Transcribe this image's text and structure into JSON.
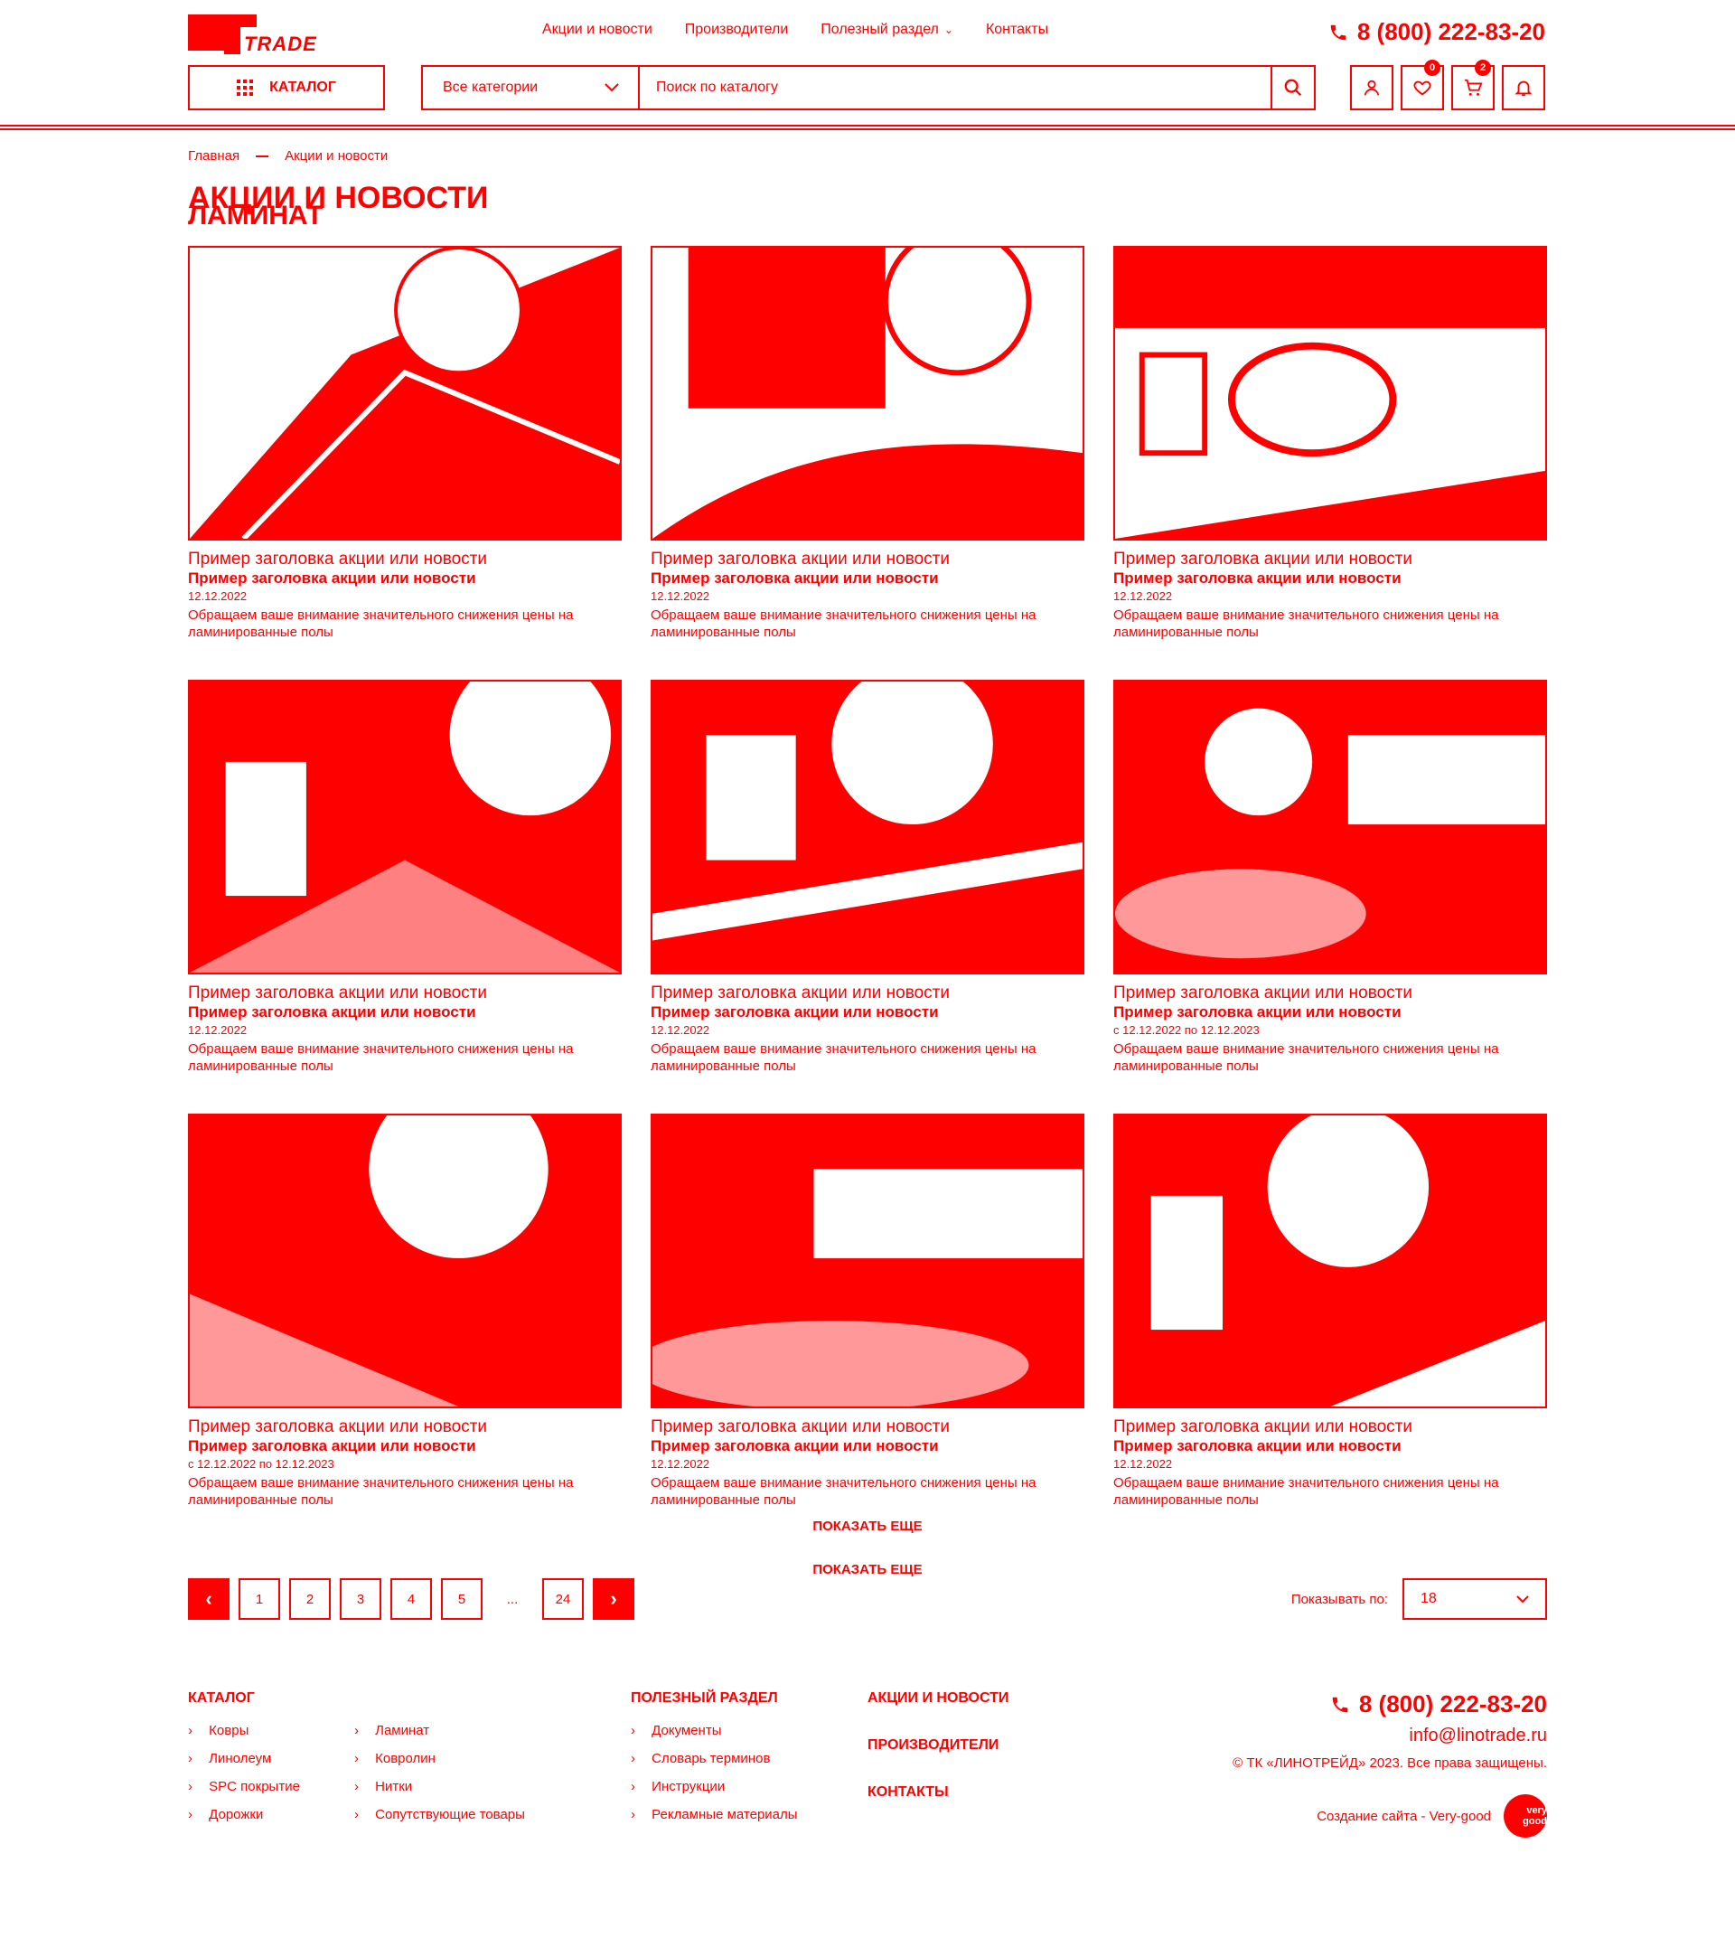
{
  "header": {
    "logo_text": "TRADE",
    "nav": [
      {
        "label": "Акции и новости"
      },
      {
        "label": "Производители"
      },
      {
        "label": "Полезный раздел",
        "dropdown": true
      },
      {
        "label": "Контакты"
      }
    ],
    "phone": "8 (800) 222-83-20",
    "catalog_label": "Каталог",
    "category_select": "Все категории",
    "search_placeholder": "Поиск по каталогу",
    "badges": {
      "favorites": "0",
      "cart": "2"
    }
  },
  "breadcrumb": {
    "home": "Главная",
    "current": "Акции и новости"
  },
  "page": {
    "title": "Акции и новости",
    "subtitle": "Ламинат"
  },
  "cards": [
    {
      "title": "Пример заголовка акции или новости",
      "date": "12.12.2022",
      "desc": "Обращаем ваше внимание значительного снижения цены на ламинированные полы"
    },
    {
      "title": "Пример заголовка акции или новости",
      "date": "12.12.2022",
      "desc": "Обращаем ваше внимание значительного снижения цены на ламинированные полы"
    },
    {
      "title": "Пример заголовка акции или новости",
      "date": "12.12.2022",
      "desc": "Обращаем ваше внимание значительного снижения цены на ламинированные полы"
    },
    {
      "title": "Пример заголовка акции или новости",
      "date": "12.12.2022",
      "desc": "Обращаем ваше внимание значительного снижения цены на ламинированные полы"
    },
    {
      "title": "Пример заголовка акции или новости",
      "date": "12.12.2022",
      "desc": "Обращаем ваше внимание значительного снижения цены на ламинированные полы"
    },
    {
      "title": "Пример заголовка акции или новости",
      "date": "с 12.12.2022 по 12.12.2023",
      "desc": "Обращаем ваше внимание значительного снижения цены на ламинированные полы"
    },
    {
      "title": "Пример заголовка акции или новости",
      "date": "с 12.12.2022 по 12.12.2023",
      "desc": "Обращаем ваше внимание значительного снижения цены на ламинированные полы"
    },
    {
      "title": "Пример заголовка акции или новости",
      "date": "12.12.2022",
      "desc": "Обращаем ваше внимание значительного снижения цены на ламинированные полы"
    },
    {
      "title": "Пример заголовка акции или новости",
      "date": "12.12.2022",
      "desc": "Обращаем ваше внимание значительного снижения цены на ламинированные полы"
    }
  ],
  "show_more": "Показать еще",
  "pagination": {
    "pages": [
      "1",
      "2",
      "3",
      "4",
      "5",
      "...",
      "24"
    ],
    "per_page_label": "Показывать по:",
    "per_page_value": "18"
  },
  "footer": {
    "catalog_title": "Каталог",
    "catalog_items_1": [
      "Ковры",
      "Линолеум",
      "SPC покрытие",
      "Дорожки"
    ],
    "catalog_items_2": [
      "Ламинат",
      "Ковролин",
      "Нитки",
      "Сопутствующие товары"
    ],
    "useful_title": "Полезный раздел",
    "useful_items": [
      "Документы",
      "Словарь терминов",
      "Инструкции",
      "Рекламные материалы"
    ],
    "links": [
      "Акции и новости",
      "Производители",
      "Контакты"
    ],
    "phone": "8 (800) 222-83-20",
    "email": "info@linotrade.ru",
    "copyright": "© ТК «ЛИНОТРЕЙД» 2023. Все права защищены.",
    "dev": "Создание сайта - Very-good",
    "dev_logo": "very good"
  }
}
